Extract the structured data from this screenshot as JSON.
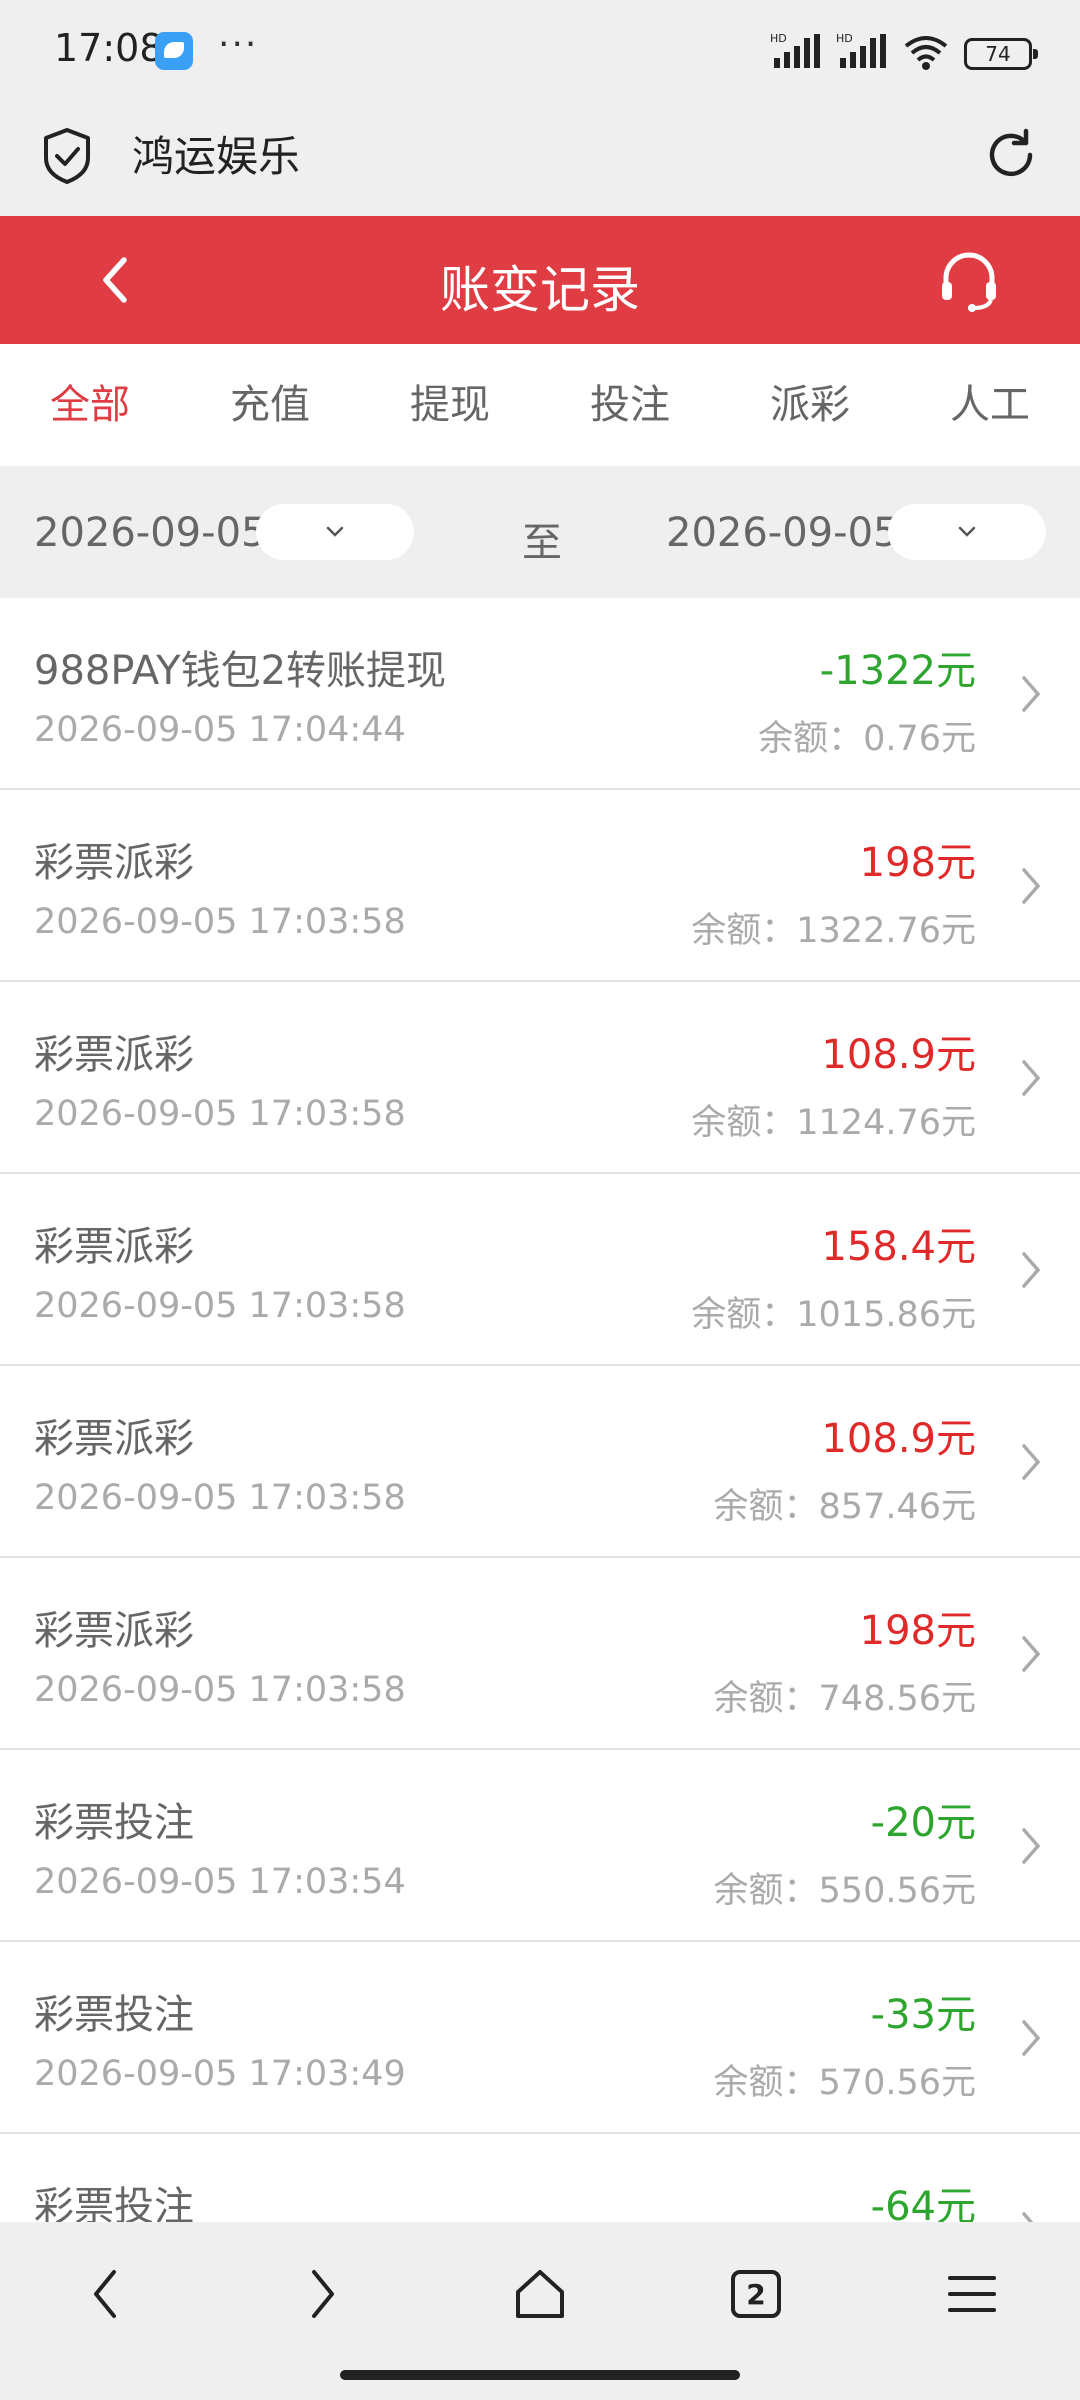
{
  "status_bar": {
    "time": "17:08",
    "more": "···",
    "network_1": "HD",
    "network_2": "HD",
    "battery": "74"
  },
  "browser": {
    "site_title": "鸿运娱乐"
  },
  "header": {
    "title": "账变记录"
  },
  "tabs": [
    {
      "label": "全部",
      "active": true
    },
    {
      "label": "充值",
      "active": false
    },
    {
      "label": "提现",
      "active": false
    },
    {
      "label": "投注",
      "active": false
    },
    {
      "label": "派彩",
      "active": false
    },
    {
      "label": "人工",
      "active": false
    }
  ],
  "date_filter": {
    "start": "2026-09-05",
    "separator": "至",
    "end": "2026-09-05"
  },
  "transactions": [
    {
      "title": "988PAY钱包2转账提现",
      "time": "2026-09-05 17:04:44",
      "amount": "-1322元",
      "balance": "余额：0.76元",
      "kind": "neg"
    },
    {
      "title": "彩票派彩",
      "time": "2026-09-05 17:03:58",
      "amount": "198元",
      "balance": "余额：1322.76元",
      "kind": "pos"
    },
    {
      "title": "彩票派彩",
      "time": "2026-09-05 17:03:58",
      "amount": "108.9元",
      "balance": "余额：1124.76元",
      "kind": "pos"
    },
    {
      "title": "彩票派彩",
      "time": "2026-09-05 17:03:58",
      "amount": "158.4元",
      "balance": "余额：1015.86元",
      "kind": "pos"
    },
    {
      "title": "彩票派彩",
      "time": "2026-09-05 17:03:58",
      "amount": "108.9元",
      "balance": "余额：857.46元",
      "kind": "pos"
    },
    {
      "title": "彩票派彩",
      "time": "2026-09-05 17:03:58",
      "amount": "198元",
      "balance": "余额：748.56元",
      "kind": "pos"
    },
    {
      "title": "彩票投注",
      "time": "2026-09-05 17:03:54",
      "amount": "-20元",
      "balance": "余额：550.56元",
      "kind": "neg"
    },
    {
      "title": "彩票投注",
      "time": "2026-09-05 17:03:49",
      "amount": "-33元",
      "balance": "余额：570.56元",
      "kind": "neg"
    },
    {
      "title": "彩票投注",
      "time": "",
      "amount": "-64元",
      "balance": "",
      "kind": "neg"
    }
  ],
  "bottom_nav": {
    "tab_count": "2"
  },
  "colors": {
    "accent_red": "#e03c44",
    "amount_negative": "#2ea52e",
    "amount_positive": "#e02a2a"
  }
}
